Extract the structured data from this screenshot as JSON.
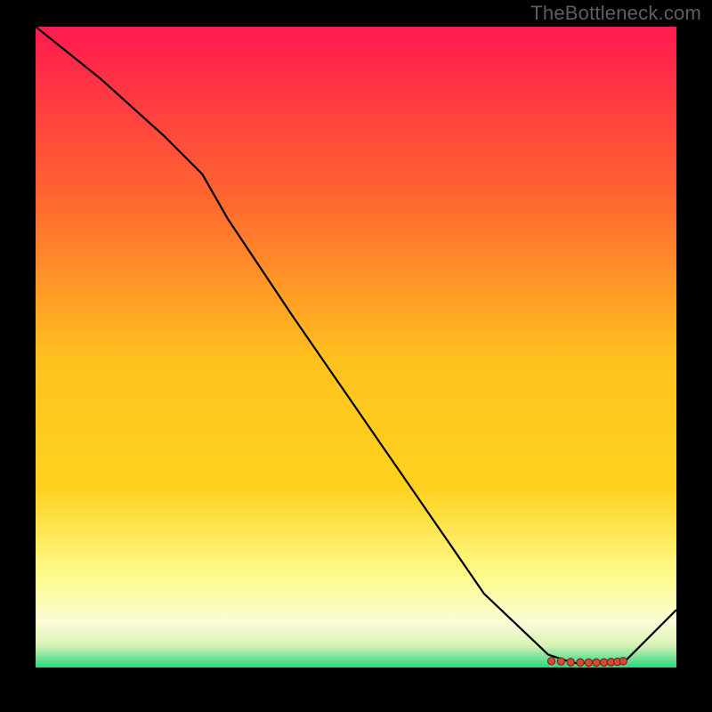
{
  "attribution": "TheBottleneck.com",
  "colors": {
    "background_black": "#000000",
    "gradient_top": "#ff1a4f",
    "gradient_upper_mid": "#ff8a2a",
    "gradient_mid": "#ffd21f",
    "gradient_lower_mid": "#fff66b",
    "gradient_cream": "#fcfccf",
    "gradient_green": "#2fd87a",
    "curve_stroke": "#000000",
    "dot_fill": "#d24a3a",
    "dot_stroke": "#6b1f17"
  },
  "chart_data": {
    "type": "line",
    "title": "",
    "xlabel": "",
    "ylabel": "",
    "xlim": [
      0,
      100
    ],
    "ylim": [
      0,
      100
    ],
    "grid": false,
    "series": [
      {
        "name": "curve",
        "x": [
          0,
          10,
          20,
          26,
          30,
          40,
          50,
          60,
          70,
          80,
          84,
          88,
          92,
          100
        ],
        "y": [
          100,
          92,
          83,
          77,
          70,
          55,
          40.5,
          26,
          11.5,
          2,
          0.7,
          0.7,
          1.0,
          9
        ]
      }
    ],
    "markers": {
      "name": "optimum-cluster",
      "x": [
        80.5,
        82,
        83.5,
        85,
        86.3,
        87.5,
        88.7,
        89.8,
        90.8,
        91.7
      ],
      "y": [
        1.0,
        0.95,
        0.85,
        0.8,
        0.78,
        0.78,
        0.8,
        0.85,
        0.9,
        1.0
      ]
    }
  }
}
